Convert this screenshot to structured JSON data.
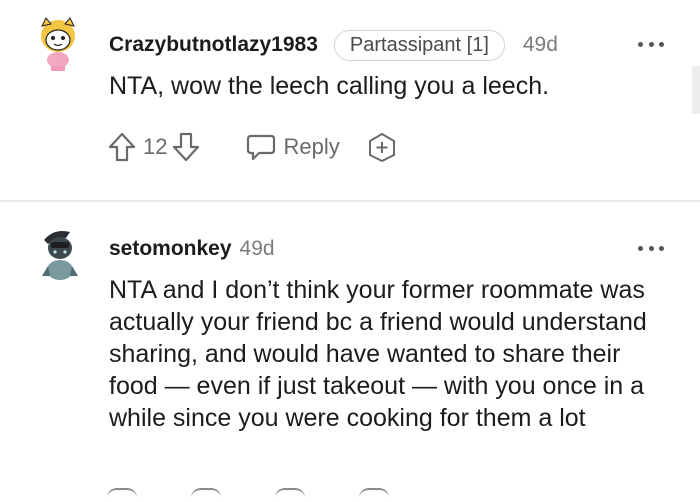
{
  "comments": [
    {
      "username": "Crazybutnotlazy1983",
      "flair": "Partassipant [1]",
      "age": "49d",
      "text": "NTA, wow the leech calling you a leech.",
      "score": "12",
      "reply_label": "Reply"
    },
    {
      "username": "setomonkey",
      "age": "49d",
      "text": "NTA and I don’t think your former roommate was actually your friend bc a friend would understand sharing, and would have wanted to share their food — even if just takeout — with you once in a while since you were cooking for them a lot"
    }
  ]
}
